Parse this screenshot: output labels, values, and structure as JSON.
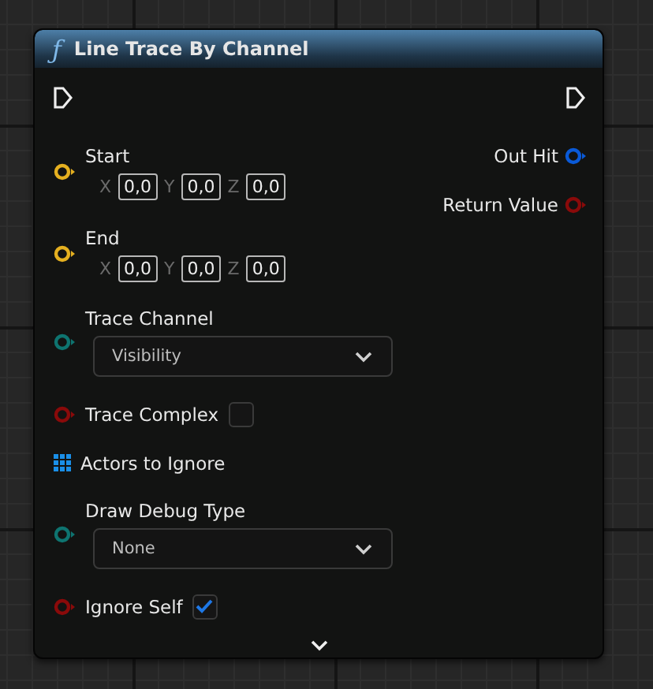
{
  "node": {
    "icon": "ƒ",
    "title": "Line Trace By Channel",
    "inputs": [
      {
        "kind": "vector",
        "label": "Start",
        "color": "#e5b020",
        "fields": [
          {
            "axis": "X",
            "value": "0,0"
          },
          {
            "axis": "Y",
            "value": "0,0"
          },
          {
            "axis": "Z",
            "value": "0,0"
          }
        ]
      },
      {
        "kind": "vector",
        "label": "End",
        "color": "#e5b020",
        "fields": [
          {
            "axis": "X",
            "value": "0,0"
          },
          {
            "axis": "Y",
            "value": "0,0"
          },
          {
            "axis": "Z",
            "value": "0,0"
          }
        ]
      },
      {
        "kind": "dropdown",
        "label": "Trace Channel",
        "color": "#0e7470",
        "value": "Visibility"
      },
      {
        "kind": "checkbox",
        "label": "Trace Complex",
        "color": "#8a0a0a",
        "checked": false
      },
      {
        "kind": "array",
        "label": "Actors to Ignore",
        "color": "#1a8fe8"
      },
      {
        "kind": "dropdown",
        "label": "Draw Debug Type",
        "color": "#0e7470",
        "value": "None"
      },
      {
        "kind": "checkbox",
        "label": "Ignore Self",
        "color": "#8a0a0a",
        "checked": true
      }
    ],
    "outputs": [
      {
        "label": "Out Hit",
        "color": "#0a5ad8"
      },
      {
        "label": "Return Value",
        "color": "#8a0a0a"
      }
    ]
  }
}
